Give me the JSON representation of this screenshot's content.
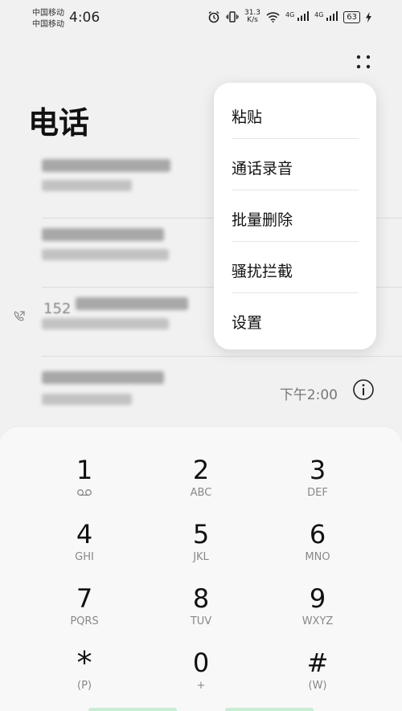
{
  "status_bar": {
    "carrier_1": "中国移动",
    "carrier_2": "中国移动",
    "time": "4:06",
    "speed_value": "31.3",
    "speed_unit": "K/s",
    "net_1": "4G",
    "net_2": "4G",
    "battery": "63"
  },
  "page": {
    "title": "电话"
  },
  "call_log": {
    "items": [
      {
        "time": ""
      },
      {
        "time": ""
      },
      {
        "number_prefix": "152",
        "time": ""
      },
      {
        "time": "下午2:00"
      }
    ]
  },
  "menu": {
    "items": [
      "粘贴",
      "通话录音",
      "批量删除",
      "骚扰拦截",
      "设置"
    ]
  },
  "dialpad": {
    "keys": [
      {
        "digit": "1",
        "letters": ""
      },
      {
        "digit": "2",
        "letters": "ABC"
      },
      {
        "digit": "3",
        "letters": "DEF"
      },
      {
        "digit": "4",
        "letters": "GHI"
      },
      {
        "digit": "5",
        "letters": "JKL"
      },
      {
        "digit": "6",
        "letters": "MNO"
      },
      {
        "digit": "7",
        "letters": "PQRS"
      },
      {
        "digit": "8",
        "letters": "TUV"
      },
      {
        "digit": "9",
        "letters": "WXYZ"
      },
      {
        "digit": "*",
        "letters": "(P)"
      },
      {
        "digit": "0",
        "letters": "+"
      },
      {
        "digit": "#",
        "letters": "(W)"
      }
    ]
  },
  "icons": {
    "more": "more-dots-icon",
    "info": "info-icon",
    "voicemail": "voicemail-icon",
    "call_type": "call-forward-icon"
  }
}
